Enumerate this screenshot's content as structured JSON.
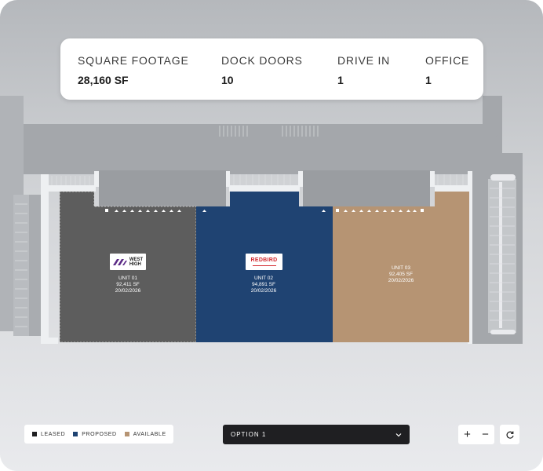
{
  "stats": [
    {
      "label": "SQUARE FOOTAGE",
      "value": "28,160 SF"
    },
    {
      "label": "DOCK DOORS",
      "value": "10"
    },
    {
      "label": "DRIVE IN",
      "value": "1"
    },
    {
      "label": "OFFICE",
      "value": "1"
    }
  ],
  "units": [
    {
      "name": "UNIT 01",
      "area": "92,411 SF",
      "date": "20/02/2026",
      "status": "LEASED",
      "tenant_logo": "WEST HIGH",
      "color": "#5d5d5d"
    },
    {
      "name": "UNIT 02",
      "area": "94,891 SF",
      "date": "20/02/2026",
      "status": "PROPOSED",
      "tenant_logo": "REDBIRD",
      "color": "#1f4372"
    },
    {
      "name": "UNIT 03",
      "area": "92,405 SF",
      "date": "20/02/2026",
      "status": "AVAILABLE",
      "color": "#b69473"
    }
  ],
  "logos": {
    "west_high": {
      "line1": "WEST",
      "line2": "HIGH",
      "mark_color": "#5b2a86"
    },
    "redbird": {
      "text": "REDBIRD",
      "color": "#d2282e"
    }
  },
  "legend": [
    {
      "label": "LEASED",
      "color": "#1f1f22"
    },
    {
      "label": "PROPOSED",
      "color": "#1f4372"
    },
    {
      "label": "AVAILABLE",
      "color": "#b69473"
    }
  ],
  "option_select": {
    "value": "OPTION 1",
    "icon": "chevron-down-icon"
  },
  "zoom": {
    "in": "+",
    "out": "−",
    "reset_icon": "refresh-icon"
  }
}
